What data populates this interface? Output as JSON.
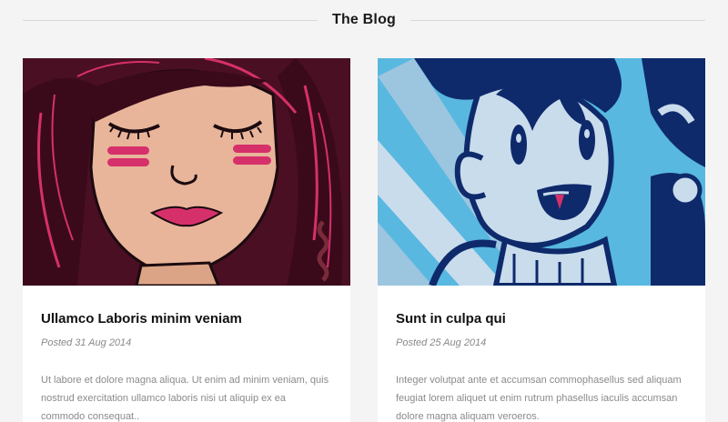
{
  "section": {
    "title": "The Blog"
  },
  "posts": [
    {
      "title": "Ullamco Laboris minim veniam",
      "date": "Posted 31 Aug 2014",
      "excerpt": "Ut labore et dolore magna aliqua. Ut enim ad minim veniam, quis nostrud exercitation ullamco laboris nisi ut aliquip ex ea commodo consequat.."
    },
    {
      "title": "Sunt in culpa qui",
      "date": "Posted 25 Aug 2014",
      "excerpt": "Integer volutpat ante et accumsan commophasellus sed aliquam feugiat lorem aliquet ut enim rutrum phasellus iaculis accumsan dolore magna aliquam veroeros."
    }
  ],
  "colors": {
    "background": "#f4f4f4",
    "card": "#ffffff",
    "hair_dark": "#4a0f22",
    "hair_pink": "#d6306b",
    "skin": "#e8b59a",
    "navy": "#0e2a6b",
    "sky": "#58b8e0",
    "pale_blue": "#c9dcec"
  }
}
